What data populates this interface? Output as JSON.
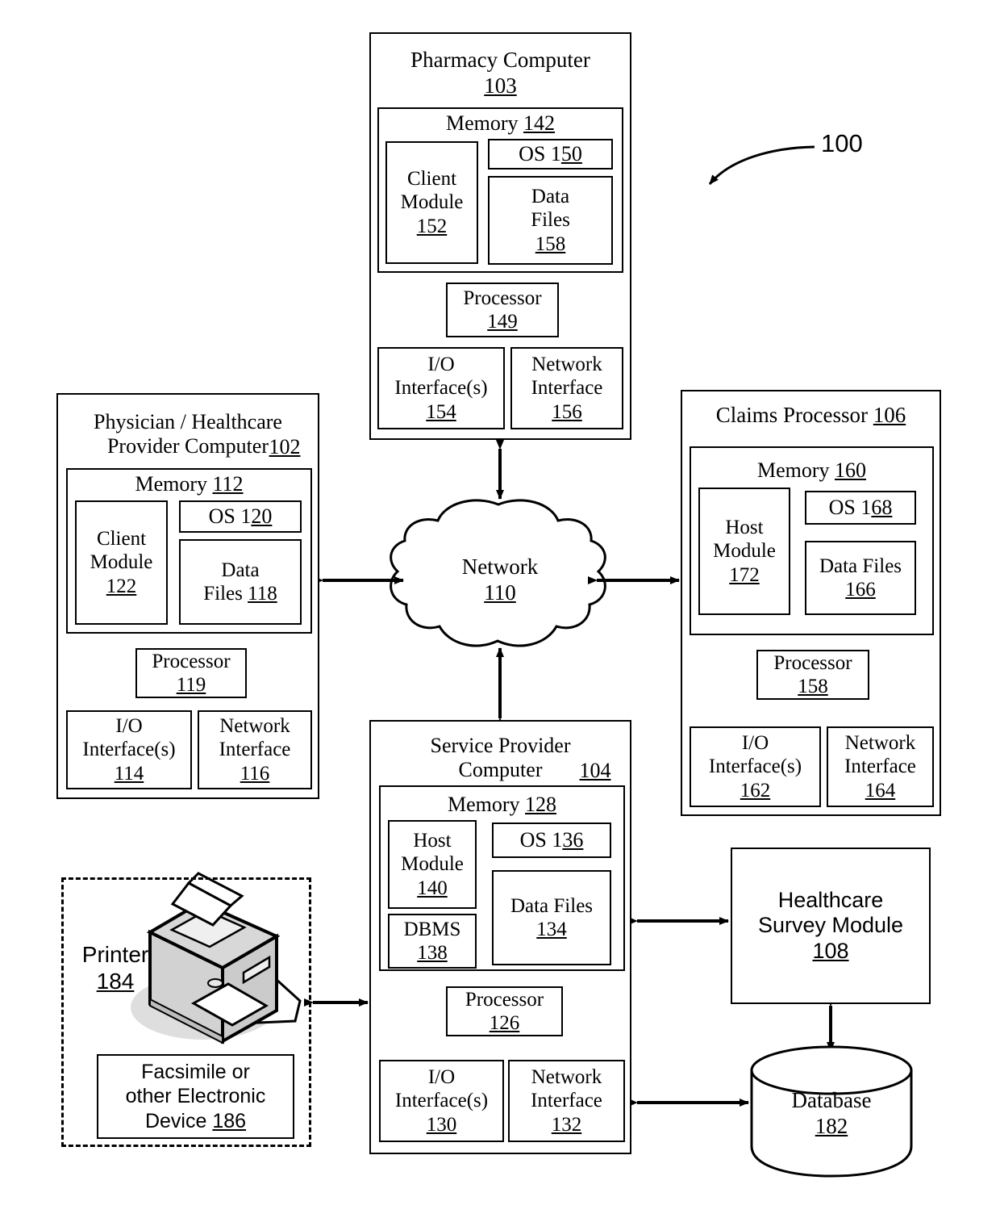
{
  "figure": {
    "reference_numeral": "100",
    "nodes": {
      "pharmacy_computer": {
        "title": "Pharmacy Computer",
        "ref": "103",
        "memory": {
          "label": "Memory",
          "ref": "142"
        },
        "client_module": {
          "label": "Client\nModule",
          "ref": "152"
        },
        "os": {
          "label": "OS 1",
          "ref": "50",
          "full": "OS 150"
        },
        "data_files": {
          "label": "Data\nFiles",
          "ref": "158"
        },
        "processor": {
          "label": "Processor",
          "ref": "149"
        },
        "io_interface": {
          "label": "I/O\nInterface(s)",
          "ref": "154"
        },
        "network_interface": {
          "label": "Network\nInterface",
          "ref": "156"
        }
      },
      "physician_computer": {
        "title": "Physician / Healthcare\nProvider  Computer",
        "ref": "102",
        "memory": {
          "label": "Memory",
          "ref": "112"
        },
        "client_module": {
          "label": "Client\nModule",
          "ref": "122"
        },
        "os": {
          "label": "OS 1",
          "ref": "20",
          "full": "OS 120"
        },
        "data_files": {
          "label": "Data\nFiles",
          "ref": "118"
        },
        "processor": {
          "label": "Processor",
          "ref": "119"
        },
        "io_interface": {
          "label": "I/O\nInterface(s)",
          "ref": "114"
        },
        "network_interface": {
          "label": "Network\nInterface",
          "ref": "116"
        }
      },
      "claims_processor": {
        "title": "Claims Processor",
        "ref": "106",
        "memory": {
          "label": "Memory",
          "ref": "160"
        },
        "host_module": {
          "label": "Host\nModule",
          "ref": "172"
        },
        "os": {
          "label": "OS 1",
          "ref": "68",
          "full": "OS 168"
        },
        "data_files": {
          "label": "Data Files",
          "ref": "166"
        },
        "processor": {
          "label": "Processor",
          "ref": "158"
        },
        "io_interface": {
          "label": "I/O\nInterface(s)",
          "ref": "162"
        },
        "network_interface": {
          "label": "Network\nInterface",
          "ref": "164"
        }
      },
      "service_provider_computer": {
        "title": "Service Provider\nComputer",
        "ref": "104",
        "memory": {
          "label": "Memory",
          "ref": "128"
        },
        "host_module": {
          "label": "Host\nModule",
          "ref": "140"
        },
        "dbms": {
          "label": "DBMS",
          "ref": "138"
        },
        "os": {
          "label": "OS 1",
          "ref": "36",
          "full": "OS 136"
        },
        "data_files": {
          "label": "Data Files",
          "ref": "134"
        },
        "processor": {
          "label": "Processor",
          "ref": "126"
        },
        "io_interface": {
          "label": "I/O\nInterface(s)",
          "ref": "130"
        },
        "network_interface": {
          "label": "Network\nInterface",
          "ref": "132"
        }
      },
      "network": {
        "label": "Network",
        "ref": "110"
      },
      "healthcare_survey_module": {
        "label": "Healthcare\nSurvey Module",
        "ref": "108"
      },
      "database": {
        "label": "Database",
        "ref": "182"
      },
      "printer": {
        "label": "Printer",
        "ref": "184"
      },
      "facsimile": {
        "label": "Facsimile or\nother Electronic\nDevice",
        "ref": "186"
      }
    },
    "connectors": [
      {
        "name": "pharmacy-to-network",
        "kind": "double-arrow",
        "orientation": "vertical"
      },
      {
        "name": "physician-to-network",
        "kind": "double-arrow",
        "orientation": "horizontal"
      },
      {
        "name": "claims-to-network",
        "kind": "double-arrow",
        "orientation": "horizontal"
      },
      {
        "name": "service-provider-to-network",
        "kind": "double-arrow",
        "orientation": "vertical"
      },
      {
        "name": "service-provider-to-survey-module",
        "kind": "double-arrow",
        "orientation": "horizontal"
      },
      {
        "name": "survey-module-to-database",
        "kind": "double-arrow",
        "orientation": "vertical"
      },
      {
        "name": "network-interface-to-database",
        "kind": "double-arrow",
        "orientation": "horizontal"
      },
      {
        "name": "printer-group-to-service-provider",
        "kind": "double-arrow",
        "orientation": "horizontal"
      }
    ],
    "colors": {
      "line": "#000000",
      "background": "#ffffff",
      "printer_fill": "#cfcfcf"
    }
  }
}
